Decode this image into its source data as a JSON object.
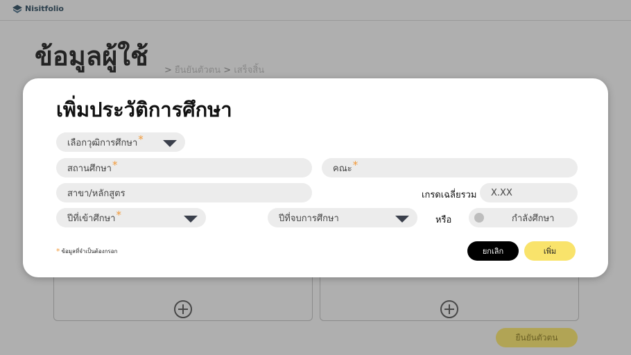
{
  "app": {
    "name": "Nisitfolio"
  },
  "page": {
    "title": "ข้อมูลผู้ใช้",
    "breadcrumb": {
      "sep1": ">",
      "step1": "ยืนยันตัวตน",
      "sep2": ">",
      "step2": "เสร็จสิ้น"
    },
    "confirm_button": "ยืนยันตัวตน"
  },
  "modal": {
    "title": "เพิ่มประวัติการศึกษา",
    "degree_select": {
      "label": "เลือกวุฒิการศึกษา",
      "required_mark": "*"
    },
    "institution_field": {
      "placeholder": "สถานศึกษา",
      "required_mark": "*"
    },
    "faculty_field": {
      "placeholder": "คณะ",
      "required_mark": "*"
    },
    "major_field": {
      "placeholder": "สาขา/หลักสูตร"
    },
    "gpa": {
      "label": "เกรดเฉลี่ยรวม",
      "placeholder": "X.XX"
    },
    "start_year_select": {
      "label": "ปีที่เข้าศึกษา",
      "required_mark": "*"
    },
    "end_year_select": {
      "label": "ปีที่จบการศึกษา"
    },
    "or_label": "หรือ",
    "studying_toggle": {
      "label": "กำลังศึกษา"
    },
    "required_note": {
      "mark": "*",
      "text": "ข้อมูลที่จำเป็นต้องกรอก"
    },
    "cancel_button": "ยกเลิก",
    "add_button": "เพิ่ม"
  },
  "colors": {
    "required": "#f29a3a",
    "primary_yellow": "#f9e36b",
    "dark": "#000000",
    "field_bg": "#ececec"
  }
}
